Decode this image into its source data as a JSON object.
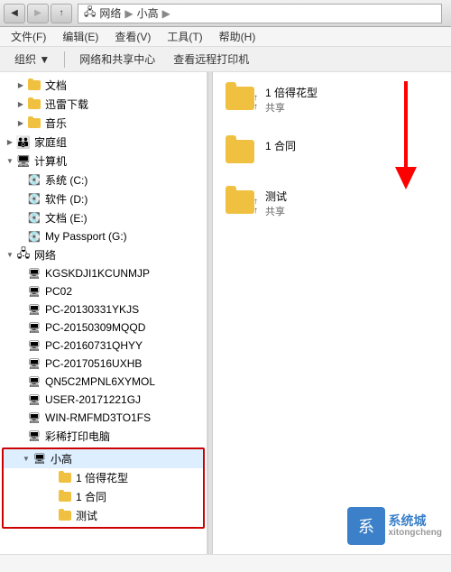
{
  "titlebar": {
    "path": [
      "网络",
      "小高"
    ]
  },
  "menubar": {
    "items": [
      {
        "label": "文件(F)"
      },
      {
        "label": "编辑(E)"
      },
      {
        "label": "查看(V)"
      },
      {
        "label": "工具(T)"
      },
      {
        "label": "帮助(H)"
      }
    ]
  },
  "toolbar": {
    "organize": "组织 ▼",
    "network_share": "网络和共享中心",
    "remote_printer": "查看远程打印机"
  },
  "sidebar": {
    "items": [
      {
        "label": "文档",
        "indent": 1,
        "arrow": "right",
        "icon": "folder"
      },
      {
        "label": "迅雷下载",
        "indent": 1,
        "arrow": "right",
        "icon": "folder"
      },
      {
        "label": "音乐",
        "indent": 1,
        "arrow": "right",
        "icon": "folder"
      },
      {
        "label": "家庭组",
        "indent": 0,
        "arrow": "right",
        "icon": "homegroup"
      },
      {
        "label": "计算机",
        "indent": 0,
        "arrow": "down",
        "icon": "computer"
      },
      {
        "label": "系统 (C:)",
        "indent": 1,
        "arrow": "empty",
        "icon": "drive"
      },
      {
        "label": "软件 (D:)",
        "indent": 1,
        "arrow": "empty",
        "icon": "drive"
      },
      {
        "label": "文档 (E:)",
        "indent": 1,
        "arrow": "empty",
        "icon": "drive"
      },
      {
        "label": "My Passport (G:)",
        "indent": 1,
        "arrow": "empty",
        "icon": "drive"
      },
      {
        "label": "网络",
        "indent": 0,
        "arrow": "down",
        "icon": "network"
      },
      {
        "label": "KGSKDJI1KCUNMJP",
        "indent": 1,
        "arrow": "empty",
        "icon": "pc"
      },
      {
        "label": "PC02",
        "indent": 1,
        "arrow": "empty",
        "icon": "pc"
      },
      {
        "label": "PC-20130331YKJS",
        "indent": 1,
        "arrow": "empty",
        "icon": "pc"
      },
      {
        "label": "PC-20150309MQQD",
        "indent": 1,
        "arrow": "empty",
        "icon": "pc"
      },
      {
        "label": "PC-20160731QHYY",
        "indent": 1,
        "arrow": "empty",
        "icon": "pc"
      },
      {
        "label": "PC-20170516UXHB",
        "indent": 1,
        "arrow": "empty",
        "icon": "pc"
      },
      {
        "label": "QN5C2MPNL6XYMOL",
        "indent": 1,
        "arrow": "empty",
        "icon": "pc"
      },
      {
        "label": "USER-20171221GJ",
        "indent": 1,
        "arrow": "empty",
        "icon": "pc"
      },
      {
        "label": "WIN-RMFMD3TO1FS",
        "indent": 1,
        "arrow": "empty",
        "icon": "pc"
      },
      {
        "label": "彩稀打印电脑",
        "indent": 1,
        "arrow": "empty",
        "icon": "pc"
      },
      {
        "label": "小高",
        "indent": 1,
        "arrow": "down",
        "icon": "pc",
        "highlighted": true
      },
      {
        "label": "1  倍得花型",
        "indent": 2,
        "arrow": "empty",
        "icon": "folder"
      },
      {
        "label": "1  合同",
        "indent": 2,
        "arrow": "empty",
        "icon": "folder"
      },
      {
        "label": "测试",
        "indent": 2,
        "arrow": "empty",
        "icon": "folder"
      }
    ]
  },
  "rightpanel": {
    "files": [
      {
        "name": "1  倍得花型",
        "shared": "共享"
      },
      {
        "name": "1  合同",
        "shared": ""
      },
      {
        "name": "测试",
        "shared": "共享"
      }
    ]
  },
  "statusbar": {
    "text": ""
  },
  "watermark": {
    "site": "系统城",
    "url": "xitongcheng"
  }
}
